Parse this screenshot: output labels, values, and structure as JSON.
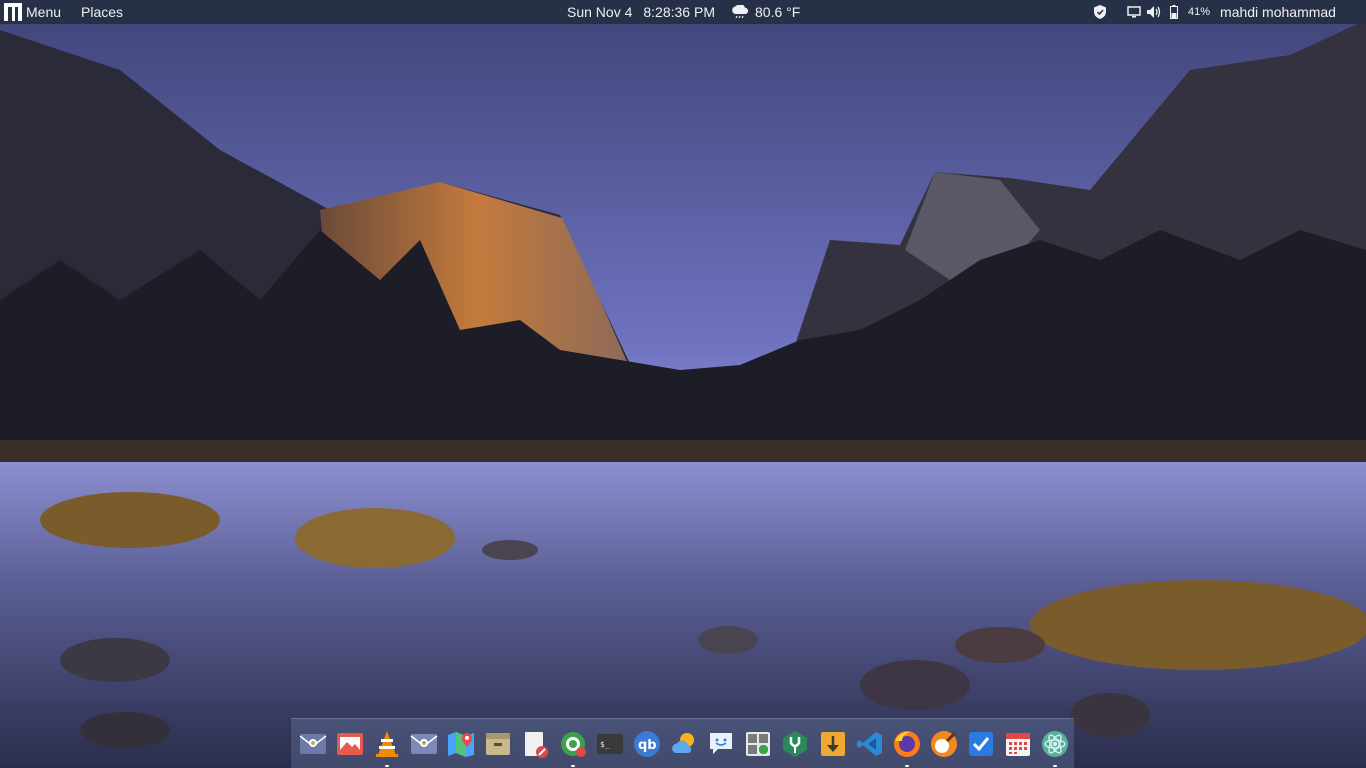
{
  "topbar": {
    "menu_label": "Menu",
    "places_label": "Places",
    "date": "Sun Nov 4",
    "time": "8:28:36 PM",
    "weather_temp": "80.6 °F",
    "battery_percent": "41%",
    "user_name": "mahdi mohammad",
    "tray_icons": [
      "shield-icon",
      "screen-icon",
      "volume-icon",
      "battery-icon"
    ]
  },
  "dock": {
    "apps": [
      {
        "name": "mail-app"
      },
      {
        "name": "image-viewer-app"
      },
      {
        "name": "vlc-app"
      },
      {
        "name": "mail-app-2"
      },
      {
        "name": "maps-app"
      },
      {
        "name": "archive-manager-app"
      },
      {
        "name": "text-editor-app"
      },
      {
        "name": "software-center-app"
      },
      {
        "name": "terminal-app"
      },
      {
        "name": "qbittorrent-app"
      },
      {
        "name": "weather-app"
      },
      {
        "name": "chat-app"
      },
      {
        "name": "calculator-app"
      },
      {
        "name": "network-tool-app"
      },
      {
        "name": "download-manager-app"
      },
      {
        "name": "vscode-app"
      },
      {
        "name": "firefox-app"
      },
      {
        "name": "paint-app"
      },
      {
        "name": "tasks-app"
      },
      {
        "name": "calendar-app"
      },
      {
        "name": "atom-app"
      }
    ]
  },
  "colors": {
    "topbar_bg": "#263046",
    "dock_bg": "#6e82aa"
  }
}
